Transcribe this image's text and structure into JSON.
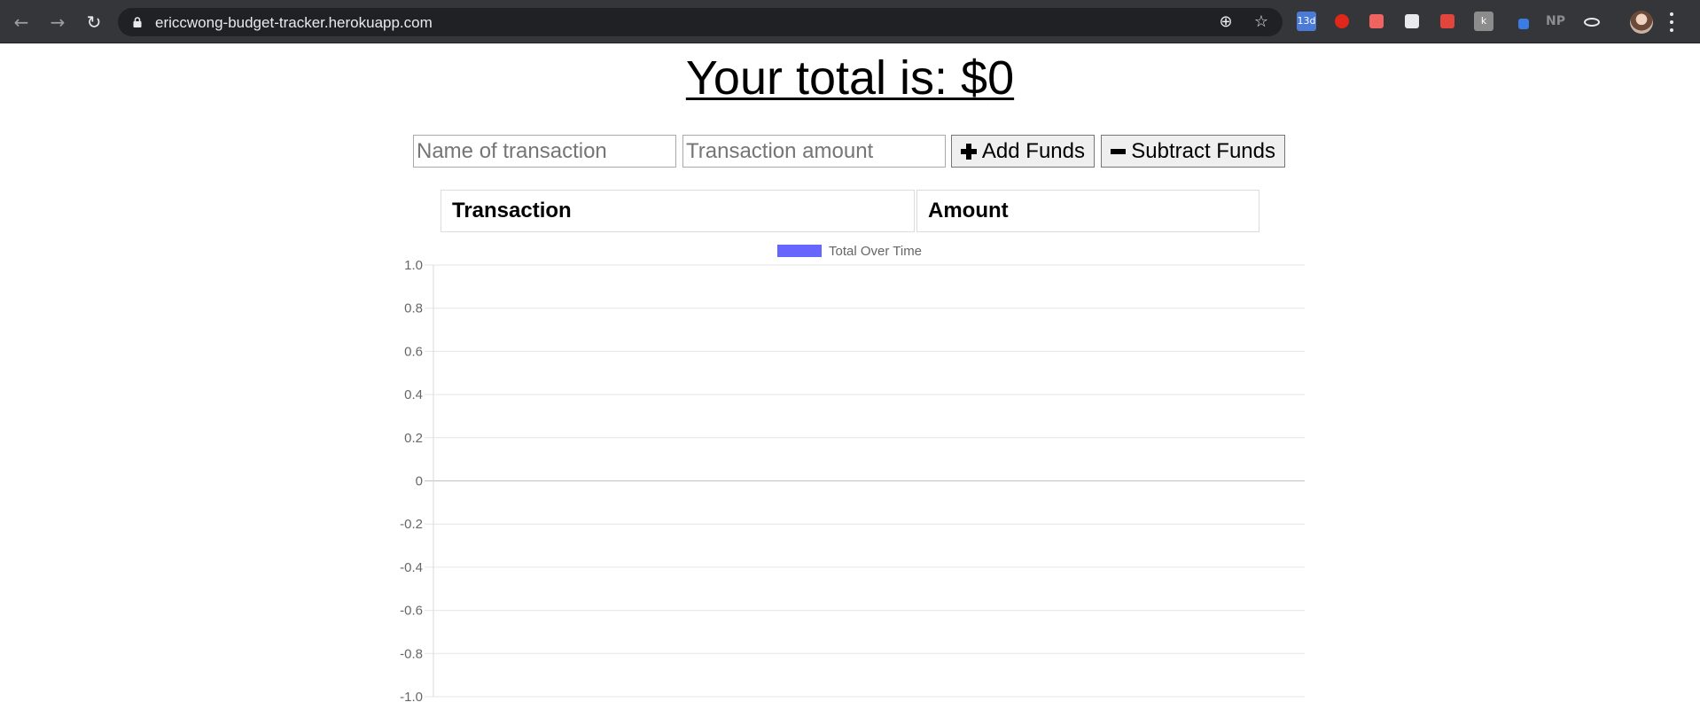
{
  "browser": {
    "url": "ericcwong-budget-tracker.herokuapp.com",
    "extensions": [
      {
        "icon": "calendar-extension-icon",
        "label": "13d",
        "color": "#4a7bd6"
      },
      {
        "icon": "adblock-extension-icon",
        "label": "",
        "color": "#e0271a"
      },
      {
        "icon": "youtube-extension-icon",
        "label": "",
        "color": "#ef6461"
      },
      {
        "icon": "ticket-extension-icon",
        "label": "",
        "color": "#e8eaed"
      },
      {
        "icon": "pdf-extension-icon",
        "label": "",
        "color": "#e2453c"
      },
      {
        "icon": "k-extension-icon",
        "label": "k",
        "color": "#8c8c8c"
      },
      {
        "icon": "pen-extension-icon",
        "label": "",
        "color": "#3b7be4"
      },
      {
        "icon": "np-extension-icon",
        "label": "NP",
        "color": "#5f6368"
      },
      {
        "icon": "react-devtools-icon",
        "label": "",
        "color": "#e8eaed"
      }
    ]
  },
  "page": {
    "total_label": "Your total is: $",
    "total_value": "0",
    "name_placeholder": "Name of transaction",
    "amount_placeholder": "Transaction amount",
    "add_label": "Add Funds",
    "subtract_label": "Subtract Funds",
    "table_headers": [
      "Transaction",
      "Amount"
    ]
  },
  "chart_data": {
    "type": "line",
    "title": "",
    "x": [],
    "series": [
      {
        "name": "Total Over Time",
        "values": [],
        "color": "#6666ff"
      }
    ],
    "xlabel": "",
    "ylabel": "",
    "ylim": [
      -1.0,
      1.0
    ],
    "yticks": [
      "1.0",
      "0.8",
      "0.6",
      "0.4",
      "0.2",
      "0",
      "-0.2",
      "-0.4",
      "-0.6",
      "-0.8",
      "-1.0"
    ],
    "grid": true,
    "legend_position": "top-center"
  }
}
